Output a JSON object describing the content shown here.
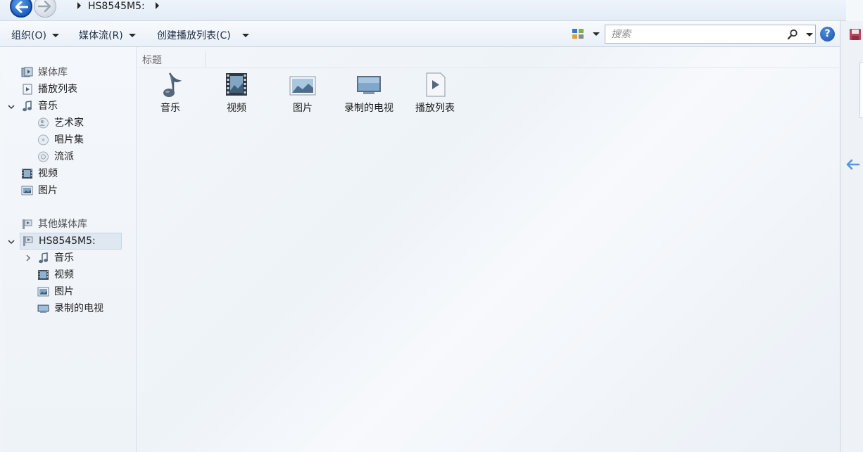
{
  "nav": {
    "breadcrumb": "HS8545M5:",
    "back_icon": "back-arrow-icon",
    "forward_icon": "forward-arrow-icon"
  },
  "toolbar": {
    "organize": "组织(O)",
    "stream": "媒体流(R)",
    "create_playlist": "创建播放列表(C)",
    "search_placeholder": "搜索",
    "view_icon": "view-options-icon",
    "help_icon": "help-icon",
    "help_glyph": "?"
  },
  "sidebar": {
    "library": "媒体库",
    "playlists": "播放列表",
    "music": "音乐",
    "artists": "艺术家",
    "albums": "唱片集",
    "genres": "流派",
    "videos": "视频",
    "pictures": "图片",
    "other_libraries": "其他媒体库",
    "device": "HS8545M5:",
    "device_music": "音乐",
    "device_videos": "视频",
    "device_pictures": "图片",
    "device_recorded_tv": "录制的电视"
  },
  "content": {
    "column_title": "标题",
    "tiles": [
      {
        "label": "音乐",
        "icon": "music-note-icon"
      },
      {
        "label": "视频",
        "icon": "film-icon"
      },
      {
        "label": "图片",
        "icon": "picture-icon"
      },
      {
        "label": "录制的电视",
        "icon": "tv-icon"
      },
      {
        "label": "播放列表",
        "icon": "playlist-icon"
      }
    ]
  },
  "colors": {
    "accent": "#1d5fc2",
    "selection": "#dfe7f1"
  }
}
